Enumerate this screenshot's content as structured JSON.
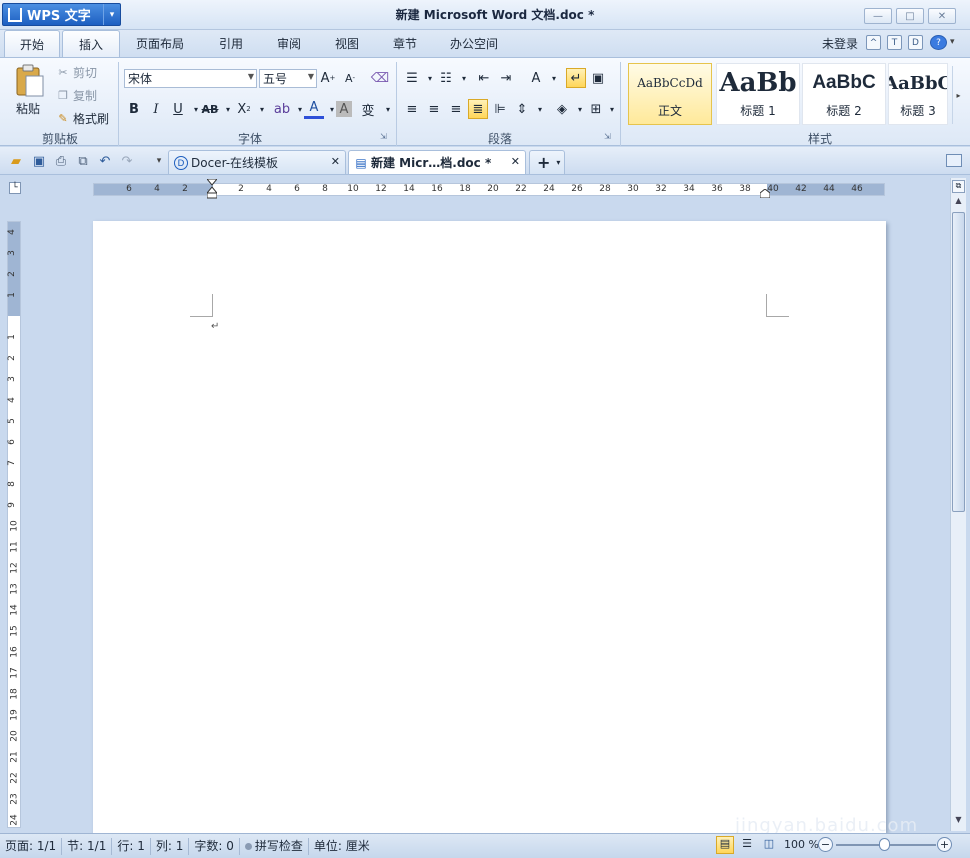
{
  "app": {
    "name": "WPS 文字",
    "dropdown": "▾"
  },
  "window": {
    "title": "新建 Microsoft Word 文档.doc *",
    "minimize": "—",
    "maximize": "□",
    "close": "✕"
  },
  "menu": {
    "tabs": [
      {
        "label": "开始"
      },
      {
        "label": "插入"
      },
      {
        "label": "页面布局"
      },
      {
        "label": "引用"
      },
      {
        "label": "审阅"
      },
      {
        "label": "视图"
      },
      {
        "label": "章节"
      },
      {
        "label": "办公空间"
      }
    ],
    "login": "未登录"
  },
  "ribbon": {
    "clipboard": {
      "paste": "粘贴",
      "cut": "剪切",
      "copy": "复制",
      "format_painter": "格式刷",
      "label": "剪贴板"
    },
    "font": {
      "name": "宋体",
      "size": "五号",
      "label": "字体"
    },
    "paragraph": {
      "label": "段落"
    },
    "styles": {
      "label": "样式",
      "items": [
        {
          "sample": "AaBbCcDd",
          "name": "正文"
        },
        {
          "sample": "AaBb",
          "name": "标题 1"
        },
        {
          "sample": "AaBbC",
          "name": "标题 2"
        },
        {
          "sample": "AaBbC",
          "name": "标题 3"
        }
      ]
    }
  },
  "doc_tabs": [
    {
      "label": "Docer-在线模板",
      "close": "✕"
    },
    {
      "label": "新建 Micr…档.doc *",
      "close": "✕"
    }
  ],
  "new_tab": "+",
  "ruler": {
    "h_left": [
      "6",
      "4",
      "2"
    ],
    "h_right": [
      "2",
      "4",
      "6",
      "8",
      "10",
      "12",
      "14",
      "16",
      "18",
      "20",
      "22",
      "24",
      "26",
      "28",
      "30",
      "32",
      "34",
      "36",
      "38",
      "40",
      "42",
      "44",
      "46"
    ],
    "v_top": [
      "4",
      "3",
      "2",
      "1"
    ],
    "v_bottom": [
      "1",
      "2",
      "3",
      "4",
      "5",
      "6",
      "7",
      "8",
      "9",
      "10",
      "11",
      "12",
      "13",
      "14",
      "15",
      "16",
      "17",
      "18",
      "19",
      "20",
      "21",
      "22",
      "23",
      "24"
    ]
  },
  "status": {
    "page": "页面: 1/1",
    "section": "节: 1/1",
    "line": "行: 1",
    "column": "列: 1",
    "word_count": "字数: 0",
    "spell_check": "拼写检查",
    "unit": "单位: 厘米",
    "zoom": "100 %"
  },
  "watermark": "jingyan.baidu.com",
  "colors": {
    "accent": "#1d5fc1",
    "ribbon_bg": "#dde8f6",
    "workspace": "#c9d9ee"
  }
}
